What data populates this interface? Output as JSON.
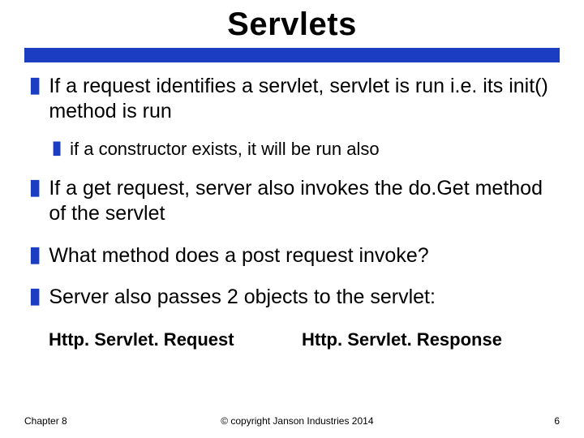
{
  "title": "Servlets",
  "bullets": {
    "b1": "If a request identifies a servlet, servlet is run i.e. its  init() method is run",
    "b1a": "if a constructor exists, it will be run also",
    "b2": "If a get request, server also invokes the do.Get method of the servlet",
    "b3": "What method does a post request invoke?",
    "b4": "Server also passes 2 objects to the servlet:"
  },
  "objects": {
    "left": "Http. Servlet. Request",
    "right": "Http. Servlet. Response"
  },
  "footer": {
    "chapter": "Chapter 8",
    "copyright": "© copyright Janson Industries 2014",
    "page": "6"
  },
  "colors": {
    "accent": "#1a3dc1"
  }
}
